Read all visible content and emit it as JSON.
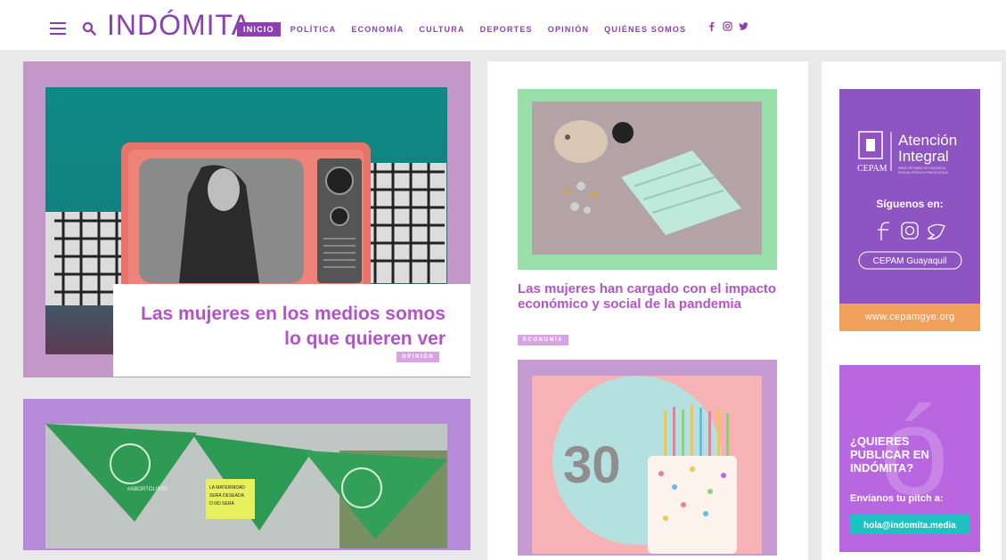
{
  "header": {
    "logo": "INDÓMITA",
    "nav": [
      "INICIO",
      "POLÍTICA",
      "ECONOMÍA",
      "CULTURA",
      "DEPORTES",
      "OPINIÓN",
      "QUIÉNES SOMOS"
    ],
    "active_nav": "INICIO",
    "social_icons": [
      "facebook-icon",
      "instagram-icon",
      "twitter-icon"
    ]
  },
  "feature": {
    "headline": "Las mujeres en los medios somos lo que quieren ver",
    "tag": "OPINIÓN"
  },
  "article_economia": {
    "headline": "Las mujeres han cargado con el impacto económico y social de la pandemia",
    "tag": "ECONOMÍA"
  },
  "ad_cepam": {
    "title_line1": "Atención",
    "title_line2": "Integral",
    "brand": "CEPAM",
    "subtitle": "PARA VÍCTIMAS DE VIOLENCIA SEXUAL FÍSICA O PSICOLÓGICA",
    "follow": "Síguenos en:",
    "handle": "CEPAM Guayaquil",
    "website": "www.cepamgye.org"
  },
  "ad_pitch": {
    "line1": "¿QUIERES",
    "line2": "PUBLICAR EN",
    "line3": "INDÓMITA?",
    "cta": "Envíanos tu pitch a:",
    "email": "hola@indomita.media"
  },
  "image_texts": {
    "banner_small": "#ABORTOLIBRE",
    "sign_text": "LA MATERNIDAD SERÁ DESEADA O NO SERÁ",
    "balloon_number": "30"
  },
  "colors": {
    "brand": "#8b3fb0",
    "headline": "#b254c8",
    "tag": "#d7a3e2"
  }
}
